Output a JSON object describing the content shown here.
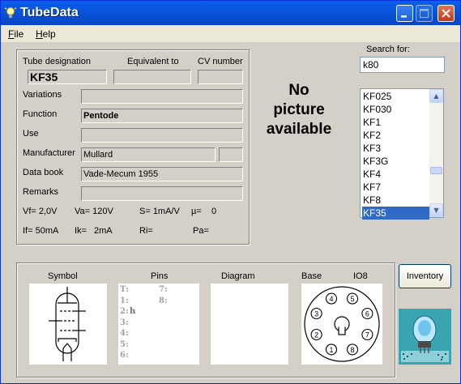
{
  "window": {
    "title": "TubeData"
  },
  "menu": [
    "File",
    "Help"
  ],
  "headers": {
    "tube_designation": "Tube designation",
    "equivalent_to": "Equivalent to",
    "cv_number": "CV number"
  },
  "fields": {
    "tube_designation": "KF35",
    "equivalent_to": "",
    "cv_number": "",
    "variations_label": "Variations",
    "variations": "",
    "function_label": "Function",
    "function": "Pentode",
    "use_label": "Use",
    "use": "",
    "manufacturer_label": "Manufacturer",
    "manufacturer": "Mullard",
    "manufacturer_extra": "",
    "databook_label": "Data book",
    "databook": "Vade-Mecum 1955",
    "remarks_label": "Remarks",
    "remarks": ""
  },
  "params": {
    "vf": "Vf= 2,0V",
    "va": "Va= 120V",
    "s": "S= 1mA/V",
    "mu": "µ=",
    "mu_val": "0",
    "if": "If= 50mA",
    "ik": "Ik=",
    "ik_val": "2mA",
    "ri": "Ri=",
    "pa": "Pa="
  },
  "picture": {
    "line1": "No",
    "line2": "picture",
    "line3": "available"
  },
  "search": {
    "label": "Search for:",
    "value": "k80"
  },
  "list": {
    "items": [
      "KF025",
      "KF030",
      "KF1",
      "KF2",
      "KF3",
      "KF3G",
      "KF4",
      "KF7",
      "KF8",
      "KF35"
    ],
    "selected": "KF35"
  },
  "bottom": {
    "symbol_label": "Symbol",
    "pins_label": "Pins",
    "diagram_label": "Diagram",
    "base_label": "Base",
    "base_type": "IO8",
    "pins": [
      {
        "n": "T:",
        "v": ""
      },
      {
        "n": "1:",
        "v": ""
      },
      {
        "n": "2:",
        "v": "h"
      },
      {
        "n": "3:",
        "v": ""
      },
      {
        "n": "4:",
        "v": ""
      },
      {
        "n": "5:",
        "v": ""
      },
      {
        "n": "6:",
        "v": ""
      },
      {
        "n": "7:",
        "v": ""
      },
      {
        "n": "8:",
        "v": ""
      }
    ],
    "base_pins": [
      "1",
      "2",
      "3",
      "4",
      "5",
      "6",
      "7",
      "8"
    ]
  },
  "inventory": {
    "label": "Inventory"
  }
}
